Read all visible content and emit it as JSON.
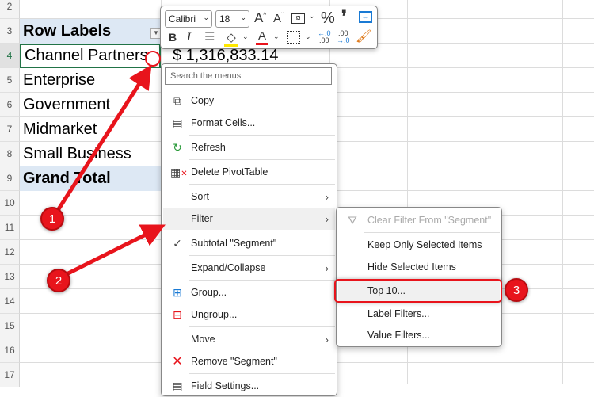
{
  "rows": [
    "2",
    "3",
    "4",
    "5",
    "6",
    "7",
    "8",
    "9",
    "10",
    "11",
    "12",
    "13",
    "14",
    "15",
    "16",
    "17"
  ],
  "pivot": {
    "header": "Row Labels",
    "items": [
      "Channel Partners",
      "Enterprise",
      "Government",
      "Midmarket",
      "Small Business"
    ],
    "grand_total": "Grand Total",
    "value_visible": "$   1,316,833.14"
  },
  "toolbar": {
    "font": "Calibri",
    "size": "18",
    "bold": "B",
    "italic": "I",
    "percent": "%",
    "comma": "❜",
    "grow": "A",
    "shrink": "A"
  },
  "context_menu": {
    "search_placeholder": "Search the menus",
    "items": [
      "Copy",
      "Format Cells...",
      "Refresh",
      "Delete PivotTable",
      "Sort",
      "Filter",
      "Subtotal \"Segment\"",
      "Expand/Collapse",
      "Group...",
      "Ungroup...",
      "Move",
      "Remove \"Segment\"",
      "Field Settings..."
    ]
  },
  "filter_submenu": {
    "items": [
      "Clear Filter From \"Segment\"",
      "Keep Only Selected Items",
      "Hide Selected Items",
      "Top 10...",
      "Label Filters...",
      "Value Filters..."
    ]
  },
  "annotations": [
    "1",
    "2",
    "3"
  ],
  "colors": {
    "accent": "#e8141c",
    "pivot_header": "#dde8f4",
    "selection": "#217346"
  }
}
